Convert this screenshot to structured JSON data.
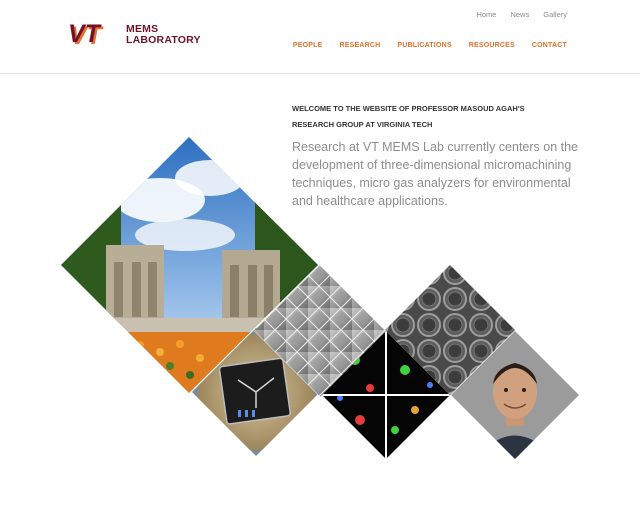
{
  "logo": {
    "mark_text": "VT",
    "line1": "MEMS",
    "line2": "LABORATORY",
    "colors": {
      "maroon": "#6f1227",
      "orange": "#e5702a"
    }
  },
  "utility_nav": [
    {
      "label": "Home"
    },
    {
      "label": "News"
    },
    {
      "label": "Gallery"
    }
  ],
  "main_nav": [
    {
      "label": "PEOPLE"
    },
    {
      "label": "RESEARCH"
    },
    {
      "label": "PUBLICATIONS"
    },
    {
      "label": "RESOURCES"
    },
    {
      "label": "CONTACT"
    }
  ],
  "hero": {
    "welcome": "WELCOME TO THE WEBSITE OF PROFESSOR MASOUD AGAH'S RESEARCH GROUP AT VIRGINIA TECH",
    "intro": "Research at VT MEMS Lab currently centers on the development of three-dimensional micromachining techniques, micro gas analyzers for environmental and healthcare applications."
  },
  "mosaic": {
    "tiles": [
      {
        "name": "campus-memorial-photo"
      },
      {
        "name": "microchip-on-coin-photo"
      },
      {
        "name": "micropyramid-sem-image"
      },
      {
        "name": "fluorescent-cells-image"
      },
      {
        "name": "micro-ring-structures-image"
      },
      {
        "name": "professor-portrait-photo"
      }
    ]
  }
}
